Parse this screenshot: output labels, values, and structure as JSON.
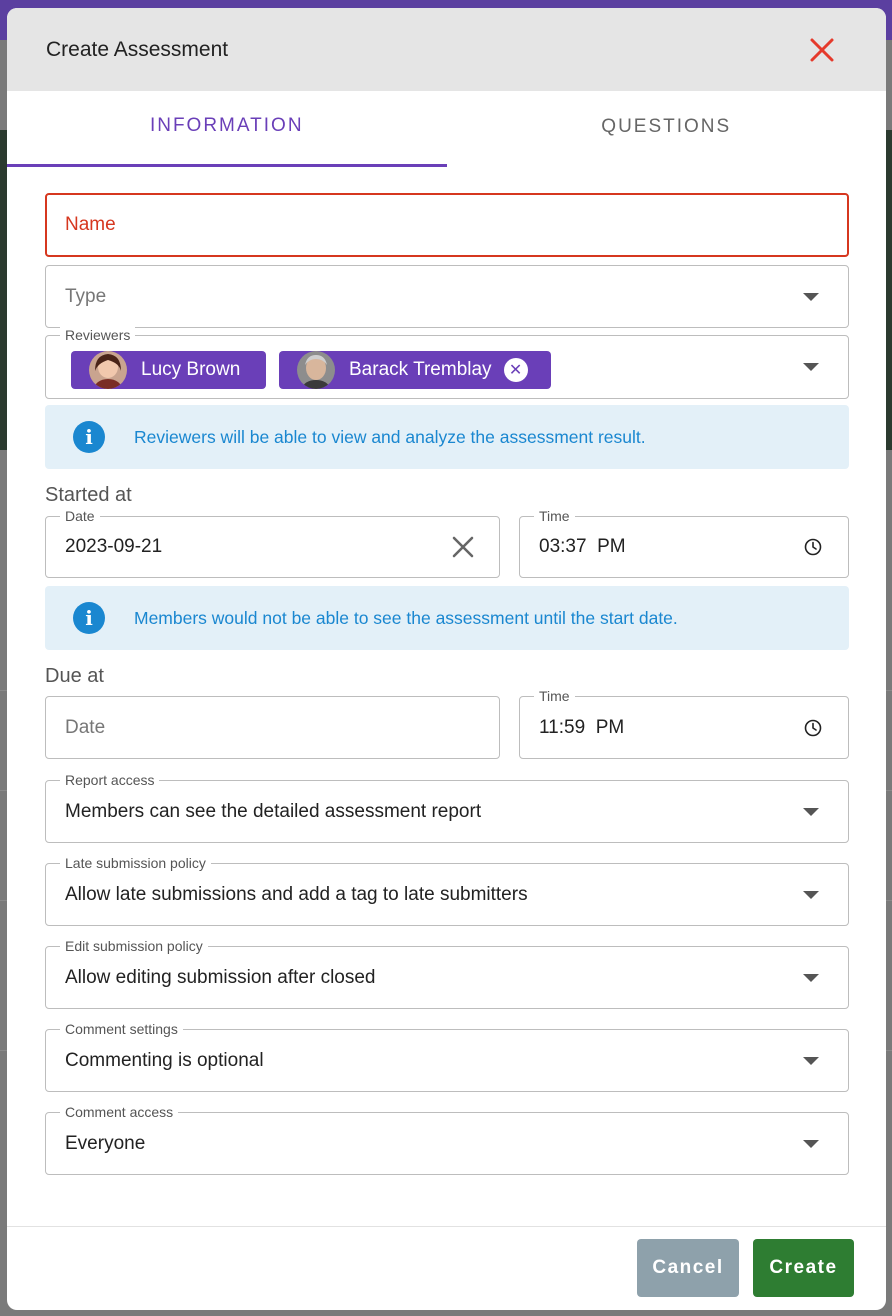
{
  "dialog": {
    "title": "Create Assessment",
    "close_icon": "close-icon"
  },
  "tabs": [
    {
      "label": "INFORMATION",
      "active": true
    },
    {
      "label": "QUESTIONS",
      "active": false
    }
  ],
  "fields": {
    "name": {
      "placeholder": "Name"
    },
    "type": {
      "placeholder": "Type"
    },
    "reviewers": {
      "label": "Reviewers",
      "chips": [
        {
          "name": "Lucy Brown",
          "removable": false
        },
        {
          "name": "Barack Tremblay",
          "removable": true
        }
      ]
    }
  },
  "reviewers_info": "Reviewers will be able to view and analyze the assessment result.",
  "started_at": {
    "title": "Started at",
    "date_label": "Date",
    "date_value": "2023-09-21",
    "time_label": "Time",
    "time_value": "03:37  PM"
  },
  "members_info": "Members would not be able to see the assessment until the start date.",
  "due_at": {
    "title": "Due at",
    "date_placeholder": "Date",
    "time_label": "Time",
    "time_value": "11:59  PM"
  },
  "selects": {
    "report_access": {
      "label": "Report access",
      "value": "Members can see the detailed assessment report"
    },
    "late_submission": {
      "label": "Late submission policy",
      "value": "Allow late submissions and add a tag to late submitters"
    },
    "edit_submission": {
      "label": "Edit submission policy",
      "value": "Allow editing submission after closed"
    },
    "comment_settings": {
      "label": "Comment settings",
      "value": "Commenting is optional"
    },
    "comment_access": {
      "label": "Comment access",
      "value": "Everyone"
    }
  },
  "footer": {
    "cancel_label": "Cancel",
    "create_label": "Create"
  },
  "colors": {
    "accent": "#6a3fb8",
    "error": "#d6371f",
    "info": "#1a87d0",
    "info_bg": "#e3f0f8",
    "create": "#2e7d32",
    "cancel": "#8ea1ab"
  }
}
